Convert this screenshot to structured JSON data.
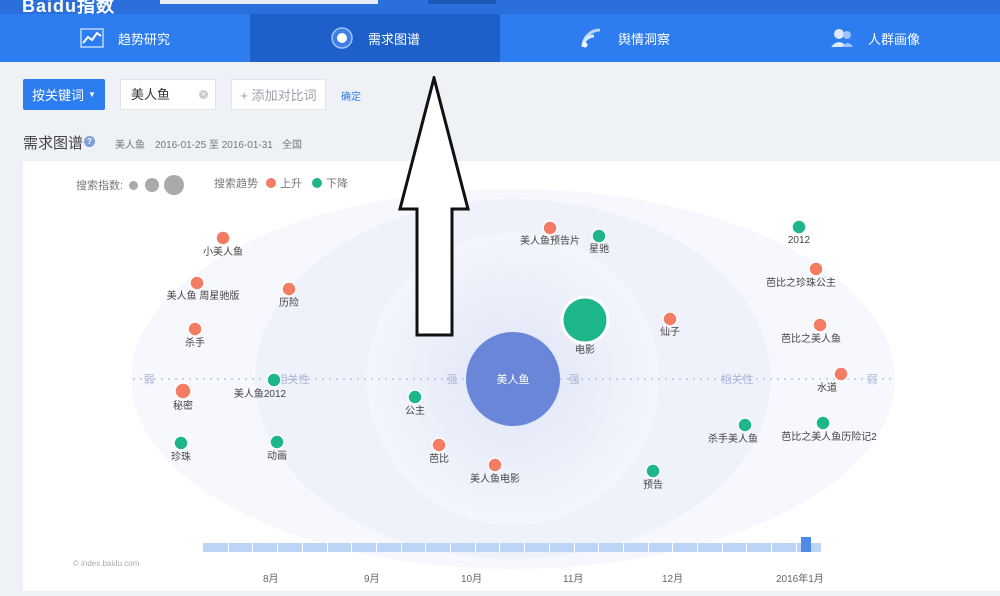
{
  "app": {
    "logo": "Baidu指数"
  },
  "nav": {
    "tabs": [
      {
        "label": "趋势研究",
        "icon": "trend-chart-icon",
        "active": false
      },
      {
        "label": "需求图谱",
        "icon": "demand-map-icon",
        "active": true
      },
      {
        "label": "舆情洞察",
        "icon": "sentiment-wave-icon",
        "active": false
      },
      {
        "label": "人群画像",
        "icon": "people-icon",
        "active": false
      }
    ]
  },
  "controls": {
    "keyword_button": "按关键词",
    "keyword_value": "美人鱼",
    "add_compare": "+ 添加对比词",
    "confirm": "确定"
  },
  "section": {
    "title": "需求图谱",
    "keyword": "美人鱼",
    "date_range": "2016-01-25 至 2016-01-31",
    "region": "全国"
  },
  "legend": {
    "search_index_label": "搜索指数:",
    "search_trend_label": "搜索趋势",
    "up_label": "上升",
    "down_label": "下降"
  },
  "colors": {
    "up": "#f47c62",
    "down": "#1db68b",
    "center": "#6a86d8",
    "primary": "#2d7cf0"
  },
  "graph": {
    "center": "美人鱼",
    "axis_labels": {
      "weak_left": "弱",
      "weak_right": "弱",
      "strong_left": "强",
      "strong_right": "强",
      "relevance_left": "相关性",
      "relevance_right": "相关性"
    },
    "nodes": [
      {
        "label": "小美人鱼",
        "trend": "up"
      },
      {
        "label": "美人鱼 周星驰版",
        "trend": "up"
      },
      {
        "label": "杀手",
        "trend": "up"
      },
      {
        "label": "秘密",
        "trend": "up"
      },
      {
        "label": "珍珠",
        "trend": "down"
      },
      {
        "label": "历险",
        "trend": "up"
      },
      {
        "label": "美人鱼2012",
        "trend": "down"
      },
      {
        "label": "动画",
        "trend": "down"
      },
      {
        "label": "公主",
        "trend": "down"
      },
      {
        "label": "芭比",
        "trend": "up"
      },
      {
        "label": "美人鱼电影",
        "trend": "up"
      },
      {
        "label": "美人鱼预告片",
        "trend": "up"
      },
      {
        "label": "星驰",
        "trend": "down"
      },
      {
        "label": "电影",
        "trend": "down"
      },
      {
        "label": "仙子",
        "trend": "up"
      },
      {
        "label": "预告",
        "trend": "down"
      },
      {
        "label": "杀手美人鱼",
        "trend": "down"
      },
      {
        "label": "2012",
        "trend": "down"
      },
      {
        "label": "芭比之珍珠公主",
        "trend": "up"
      },
      {
        "label": "芭比之美人鱼",
        "trend": "up"
      },
      {
        "label": "水道",
        "trend": "up"
      },
      {
        "label": "芭比之美人鱼历险记2",
        "trend": "down"
      }
    ]
  },
  "timeline": {
    "months": [
      "8月",
      "9月",
      "10月",
      "11月",
      "12月",
      "2016年1月"
    ]
  },
  "footer": {
    "copyright": "© index.baidu.com"
  }
}
